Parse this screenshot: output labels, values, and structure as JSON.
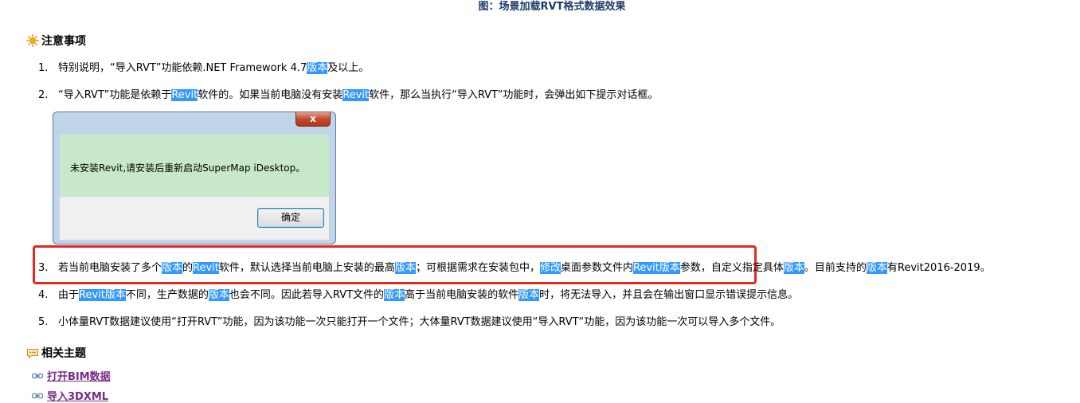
{
  "caption": "图：场景加载RVT格式数据效果",
  "notes": {
    "heading": "注意事项",
    "items": [
      {
        "num": "1.",
        "segs": [
          {
            "t": "特别说明，“导入RVT”功能依赖.NET Framework 4.7"
          },
          {
            "t": "版本",
            "hl": true
          },
          {
            "t": "及以上。"
          }
        ]
      },
      {
        "num": "2.",
        "segs": [
          {
            "t": "“导入RVT”功能是依赖于"
          },
          {
            "t": "Revit",
            "hl": true
          },
          {
            "t": "软件的。如果当前电脑没有安装"
          },
          {
            "t": "Revit",
            "hl": true
          },
          {
            "t": "软件，那么当执行“导入RVT”功能时，会弹出如下提示对话框。"
          }
        ]
      },
      {
        "num": "3.",
        "segs": [
          {
            "t": "若当前电脑安装了多个"
          },
          {
            "t": "版本",
            "hl": true
          },
          {
            "t": "的"
          },
          {
            "t": "Revit",
            "hl": true
          },
          {
            "t": "软件，默认选择当前电脑上安装的最高"
          },
          {
            "t": "版本",
            "hl": true
          },
          {
            "t": "；可根据需求在安装包中，"
          },
          {
            "t": "修改",
            "hl": true
          },
          {
            "t": "桌面参数文件内"
          },
          {
            "t": "Revit版本",
            "hl": true
          },
          {
            "t": "参数，自定义指定具体"
          },
          {
            "t": "版本",
            "hl": true
          },
          {
            "t": "。目前支持的"
          },
          {
            "t": "版本",
            "hl": true
          },
          {
            "t": "有Revit2016-2019。"
          }
        ]
      },
      {
        "num": "4.",
        "segs": [
          {
            "t": "由于"
          },
          {
            "t": "Revit版本",
            "hl": true
          },
          {
            "t": "不同，生产数据的"
          },
          {
            "t": "版本",
            "hl": true
          },
          {
            "t": "也会不同。因此若导入RVT文件的"
          },
          {
            "t": "版本",
            "hl": true
          },
          {
            "t": "高于当前电脑安装的软件"
          },
          {
            "t": "版本",
            "hl": true
          },
          {
            "t": "时，将无法导入，并且会在输出窗口显示错误提示信息。"
          }
        ]
      },
      {
        "num": "5.",
        "segs": [
          {
            "t": "小体量RVT数据建议使用“打开RVT”功能，因为该功能一次只能打开一个文件；大体量RVT数据建议使用“导入RVT“功能，因为该功能一次可以导入多个文件。"
          }
        ]
      }
    ]
  },
  "dialog": {
    "close_glyph": "x",
    "message": "未安装Revit,请安装后重新启动SuperMap iDesktop。",
    "ok_label": "确定"
  },
  "related": {
    "heading": "相关主题",
    "links": [
      "打开BIM数据",
      "导入3DXML"
    ]
  },
  "colors": {
    "highlight": "#3399ff",
    "emphasis_border": "#e32822",
    "caption": "#1f3a6e",
    "link": "#7a2a8a"
  },
  "icons": {
    "notes_heading": "sun-icon",
    "related_heading": "speech-bubble-icon",
    "related_link": "link-chain-icon"
  }
}
